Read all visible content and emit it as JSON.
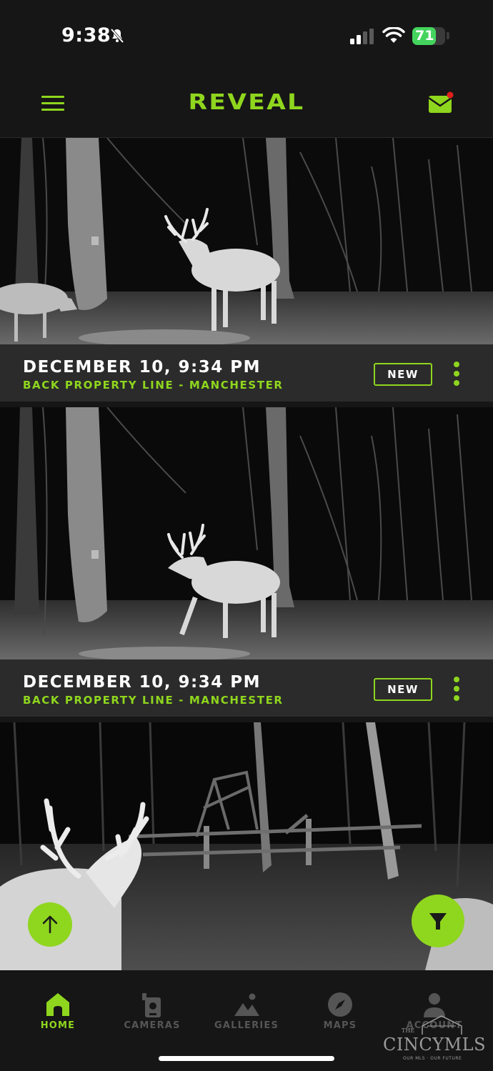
{
  "status_bar": {
    "time": "9:38",
    "battery": "71",
    "battery_level": 0.71
  },
  "header": {
    "brand": "REVEAL"
  },
  "feed": [
    {
      "date": "DECEMBER 10, 9:34 PM",
      "location": "BACK PROPERTY LINE - MANCHESTER",
      "badge": "NEW"
    },
    {
      "date": "DECEMBER 10, 9:34 PM",
      "location": "BACK PROPERTY LINE - MANCHESTER",
      "badge": "NEW"
    }
  ],
  "tabs": [
    {
      "label": "HOME",
      "icon": "home-icon",
      "active": true
    },
    {
      "label": "CAMERAS",
      "icon": "camera-icon",
      "active": false
    },
    {
      "label": "GALLERIES",
      "icon": "gallery-icon",
      "active": false
    },
    {
      "label": "MAPS",
      "icon": "compass-icon",
      "active": false
    },
    {
      "label": "ACCOUNT",
      "icon": "account-icon",
      "active": false
    }
  ],
  "watermark": {
    "prefix": "THE",
    "name": "CINCYMLS",
    "tagline": "OUR MLS · OUR FUTURE"
  },
  "colors": {
    "accent": "#8fd61e",
    "background": "#161616",
    "caption_bg": "#2b2b2b"
  }
}
